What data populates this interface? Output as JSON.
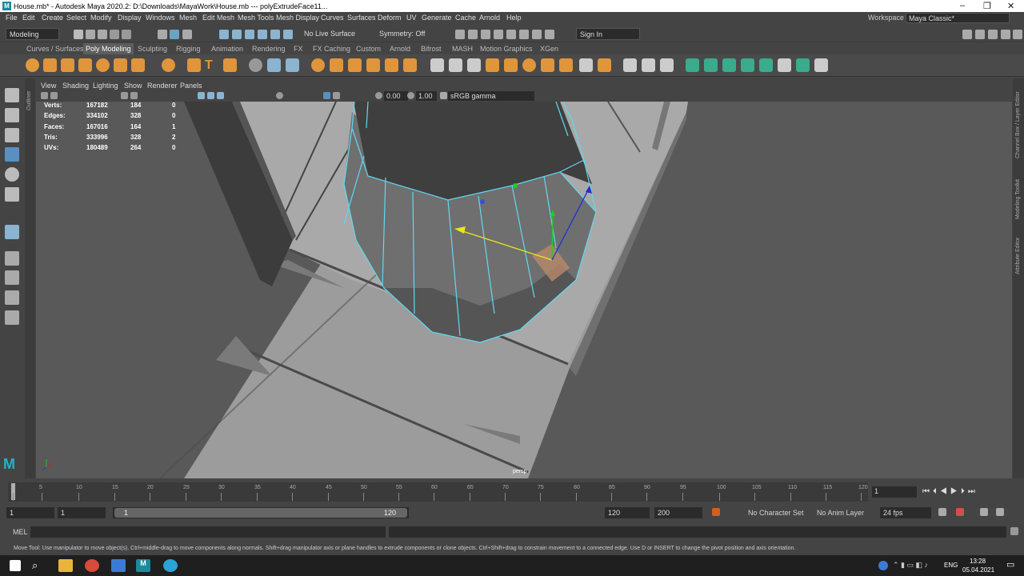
{
  "window": {
    "title": "House.mb* - Autodesk Maya 2020.2: D:\\Downloads\\MayaWork\\House.mb   ---   polyExtrudeFace11..."
  },
  "menubar": [
    "File",
    "Edit",
    "Create",
    "Select",
    "Modify",
    "Display",
    "Windows",
    "Mesh",
    "Edit Mesh",
    "Mesh Tools",
    "Mesh Display",
    "Curves",
    "Surfaces",
    "Deform",
    "UV",
    "Generate",
    "Cache",
    "Arnold",
    "Help"
  ],
  "workspace": {
    "label": "Workspace :",
    "value": "Maya Classic*"
  },
  "statusline": {
    "mode": "Modeling",
    "live_surface": "No Live Surface",
    "symmetry": "Symmetry: Off",
    "sign_in": "Sign In"
  },
  "shelf_tabs": [
    "Curves / Surfaces",
    "Poly Modeling",
    "Sculpting",
    "Rigging",
    "Animation",
    "Rendering",
    "FX",
    "FX Caching",
    "Custom",
    "Arnold",
    "Bifrost",
    "MASH",
    "Motion Graphics",
    "XGen"
  ],
  "panel_menu": [
    "View",
    "Shading",
    "Lighting",
    "Show",
    "Renderer",
    "Panels"
  ],
  "panel_toolbar": {
    "exposure": "0.00",
    "gamma": "1.00",
    "color_space": "sRGB gamma"
  },
  "hud": [
    {
      "label": "Verts:",
      "a": "167182",
      "b": "184",
      "c": "0"
    },
    {
      "label": "Edges:",
      "a": "334102",
      "b": "328",
      "c": "0"
    },
    {
      "label": "Faces:",
      "a": "167016",
      "b": "164",
      "c": "1"
    },
    {
      "label": "Tris:",
      "a": "333996",
      "b": "328",
      "c": "2"
    },
    {
      "label": "UVs:",
      "a": "180489",
      "b": "264",
      "c": "0"
    }
  ],
  "viewport": {
    "camera": "persp"
  },
  "dock_tabs": [
    "Channel Box / Layer Editor",
    "Modeling Toolkit",
    "Attribute Editor"
  ],
  "outliner_tab": "Outliner",
  "timeline": {
    "ticks": [
      "1",
      "5",
      "10",
      "15",
      "20",
      "25",
      "30",
      "35",
      "40",
      "45",
      "50",
      "55",
      "60",
      "65",
      "70",
      "75",
      "80",
      "85",
      "90",
      "95",
      "100",
      "105",
      "110",
      "115",
      "120"
    ],
    "current_frame": "1"
  },
  "range": {
    "start": "1",
    "anim_start": "1",
    "range_start": "1",
    "range_end": "120",
    "anim_end": "120",
    "end": "200",
    "character_set": "No Character Set",
    "anim_layer": "No Anim Layer",
    "fps": "24 fps"
  },
  "mel": {
    "label": "MEL"
  },
  "help_line": "Move Tool: Use manipulator to move object(s). Ctrl+middle-drag to move components along normals. Shift+drag manipulator axis or plane handles to extrude components or clone objects. Ctrl+Shift+drag to constrain movement to a connected edge. Use D or INSERT to change the pivot position and axis orientation.",
  "taskbar": {
    "lang": "ENG",
    "time": "13:28",
    "date": "05.04.2021"
  }
}
